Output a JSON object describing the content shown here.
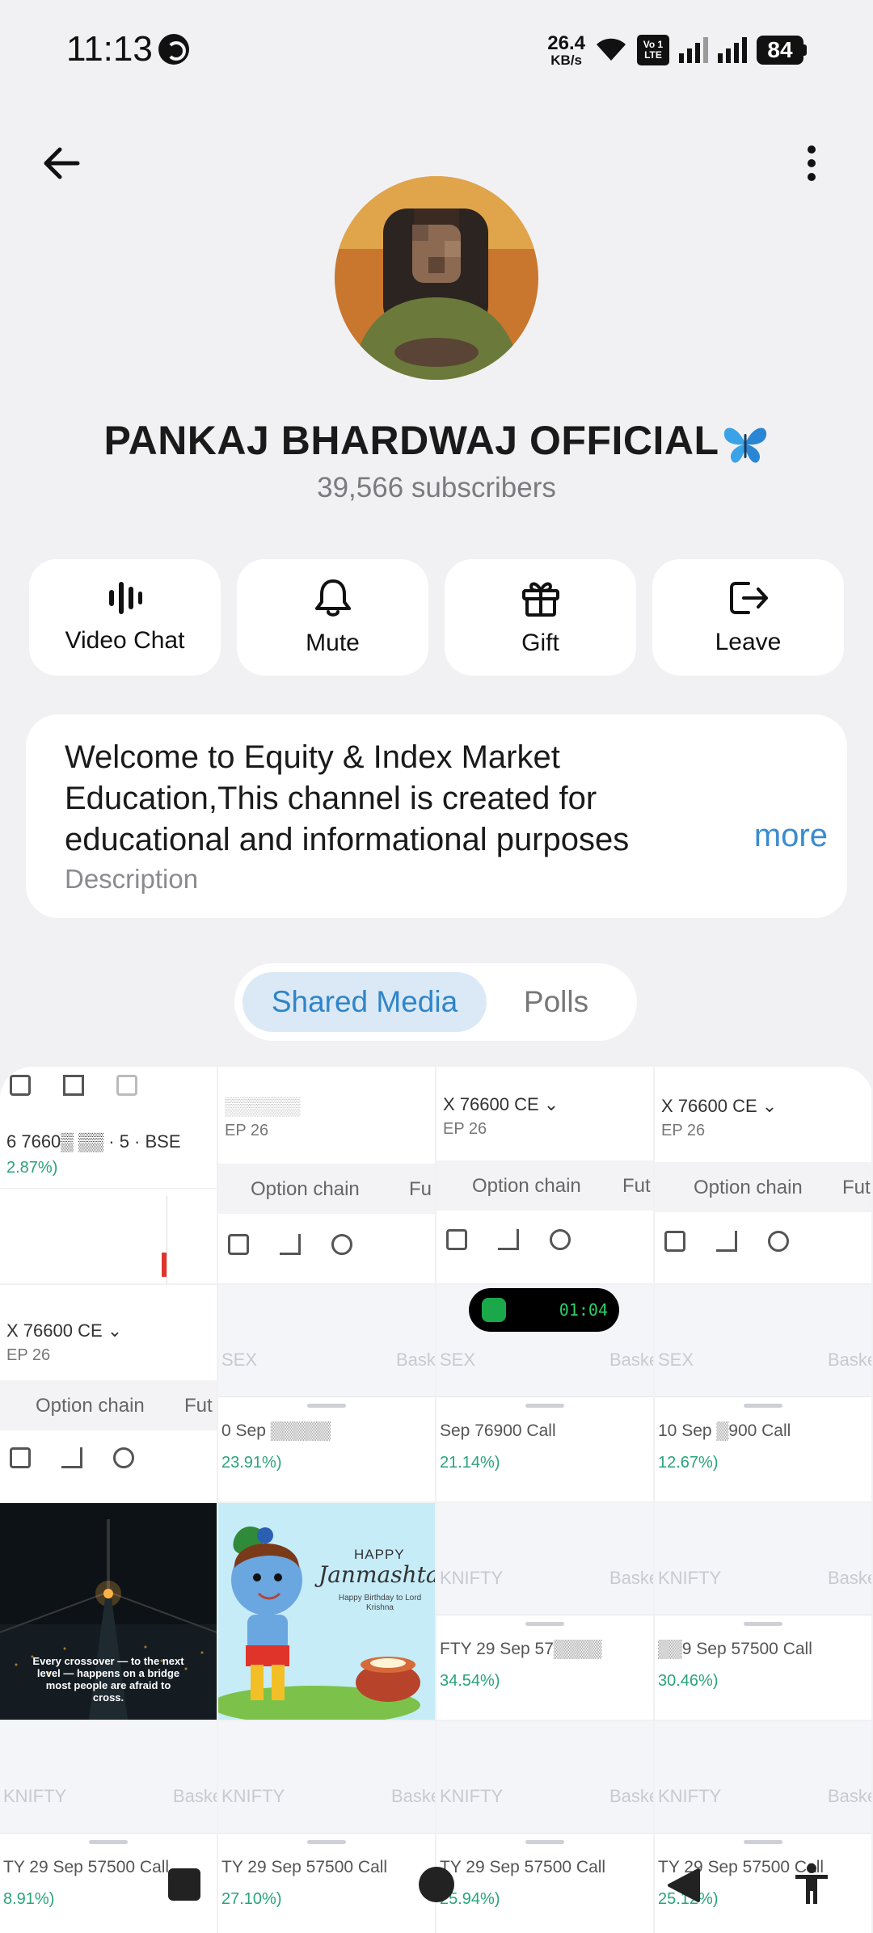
{
  "status_bar": {
    "time": "11:13",
    "net_speed_value": "26.4",
    "net_speed_unit": "KB/s",
    "volte_line1": "Vo 1",
    "volte_line2": "LTE",
    "battery": "84"
  },
  "channel": {
    "name": "PANKAJ BHARDWAJ OFFICIAL",
    "name_emoji": "butterfly-icon",
    "subscribers": "39,566 subscribers"
  },
  "actions": [
    {
      "label": "Video Chat",
      "icon": "voice-chat-icon"
    },
    {
      "label": "Mute",
      "icon": "bell-icon"
    },
    {
      "label": "Gift",
      "icon": "gift-icon"
    },
    {
      "label": "Leave",
      "icon": "leave-icon"
    }
  ],
  "description": {
    "text": "Welcome to Equity & Index Market Education,This channel is created for educational and informational purposes",
    "more": "more",
    "label": "Description"
  },
  "tabs": {
    "shared_media": "Shared Media",
    "polls": "Polls"
  },
  "media": {
    "row1": [
      {
        "t1": "6 7660▒ ▒▒ · 5 · BSE",
        "t2": "2.87%)"
      },
      {
        "t1": "▒▒▒▒▒▒",
        "t2": "EP 26"
      },
      {
        "t1": "X 76600 CE ⌄",
        "t2": "EP 26",
        "band1": "Option chain",
        "band2": "Fut"
      },
      {
        "t1": "X 76600 CE ⌄",
        "t2": "EP 26",
        "band1": "Option chain",
        "band2": "Fut"
      }
    ],
    "row1_band": {
      "option_chain": "Option chain",
      "fut": "Fu"
    },
    "row2": [
      {
        "t1": "X 76600 CE ⌄",
        "t2": "EP 26",
        "band1": "Option chain",
        "band2": "Fut"
      },
      {
        "top": "SEX",
        "call": "0 Sep ▒▒▒▒▒",
        "pct": "23.91%)",
        "sheet_top": "analytics"
      },
      {
        "top": "SEX",
        "call": "Sep 76900 Call",
        "pct": "21.14%)",
        "sheet_top": "analytics"
      },
      {
        "top": "SEX",
        "call": "10 Sep ▒900 Call",
        "pct": "12.67%)",
        "sheet_top": "analytics"
      }
    ],
    "row2_right_label": "Baske",
    "row3": [
      {
        "type": "quote-image",
        "text": "Every crossover — to the next level — happens on a bridge most people are afraid to cross."
      },
      {
        "type": "janmashtami-image",
        "title1": "HAPPY",
        "title2": "Janmashtami",
        "sub": "Happy Birthday to Lord Krishna"
      },
      {
        "top": "KNIFTY",
        "call": "FTY 29 Sep 57▒▒▒▒",
        "pct": "34.54%)"
      },
      {
        "top": "KNIFTY",
        "call": "▒▒9 Sep 57500 Call",
        "pct": "30.46%)"
      }
    ],
    "row4": [
      {
        "top": "KNIFTY",
        "call": "TY 29 Sep 57500 Call",
        "pct": "8.91%)"
      },
      {
        "top": "KNIFTY",
        "call": "TY 29 Sep 57500 Call",
        "pct": "27.10%)"
      },
      {
        "top": "KNIFTY",
        "call": "TY 29 Sep 57500 Call",
        "pct": "25.94%)"
      },
      {
        "top": "KNIFTY",
        "call": "TY 29 Sep 57500 Call",
        "pct": "25.12%)"
      }
    ],
    "call_timer": "01:04"
  },
  "colors": {
    "accent": "#3a8bd1",
    "tab_active_bg": "#dbe9f6",
    "background": "#f1f1f3",
    "avatar_bg": "#c9762e"
  }
}
